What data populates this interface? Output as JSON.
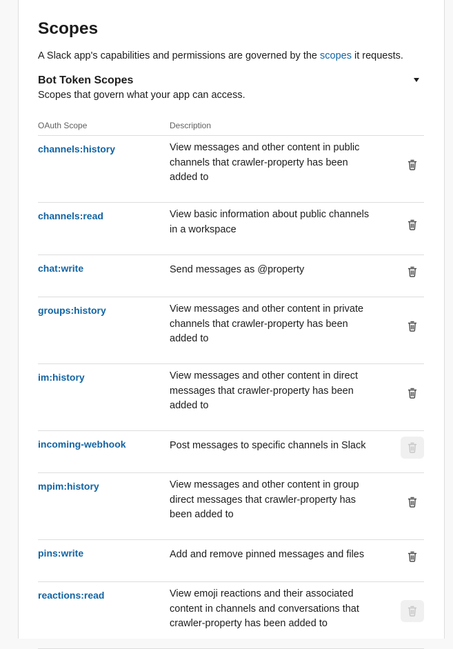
{
  "colors": {
    "link": "#1264a3",
    "text": "#1d1c1d",
    "muted": "#616061",
    "border": "#dddddd"
  },
  "page": {
    "title": "Scopes",
    "intro_before": "A Slack app's capabilities and permissions are governed by the ",
    "intro_link": "scopes",
    "intro_after": " it requests."
  },
  "section": {
    "title": "Bot Token Scopes",
    "subtitle": "Scopes that govern what your app can access.",
    "toggle_icon": "caret-down-icon"
  },
  "table": {
    "headers": [
      "OAuth Scope",
      "Description"
    ],
    "rows": [
      {
        "scope": "channels:history",
        "description": "View messages and other content in public channels that crawler-property has been added to",
        "delete_disabled": false
      },
      {
        "scope": "channels:read",
        "description": "View basic information about public channels in a workspace",
        "delete_disabled": false
      },
      {
        "scope": "chat:write",
        "description": "Send messages as @property",
        "delete_disabled": false
      },
      {
        "scope": "groups:history",
        "description": "View messages and other content in private channels that crawler-property has been added to",
        "delete_disabled": false
      },
      {
        "scope": "im:history",
        "description": "View messages and other content in direct messages that crawler-property has been added to",
        "delete_disabled": false
      },
      {
        "scope": "incoming-webhook",
        "description": "Post messages to specific channels in Slack",
        "delete_disabled": true
      },
      {
        "scope": "mpim:history",
        "description": "View messages and other content in group direct messages that crawler-property has been added to",
        "delete_disabled": false
      },
      {
        "scope": "pins:write",
        "description": "Add and remove pinned messages and files",
        "delete_disabled": false
      },
      {
        "scope": "reactions:read",
        "description": "View emoji reactions and their associated content in channels and conversations that crawler-property has been added to",
        "delete_disabled": true
      }
    ]
  }
}
